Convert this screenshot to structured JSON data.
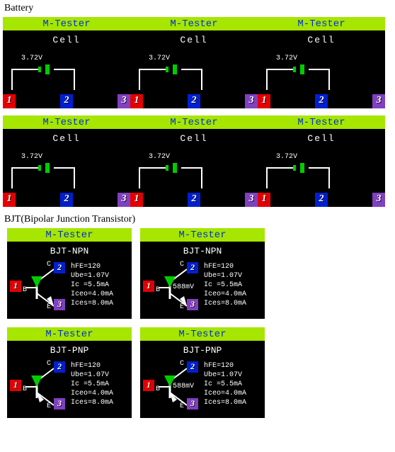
{
  "sections": {
    "battery": "Battery",
    "bjt": "BJT(Bipolar Junction Transistor)"
  },
  "header": "M-Tester",
  "cell": {
    "label": "Cell",
    "voltage": "3.72V"
  },
  "pins": {
    "p1": "1",
    "p2": "2",
    "p3": "3"
  },
  "terms": {
    "B": "B",
    "C": "C",
    "E": "E"
  },
  "bjt": {
    "npn": "BJT-NPN",
    "pnp": "BJT-PNP",
    "vbe_inline": "588mV",
    "params": {
      "hfe": "hFE=120",
      "ube": "Ube=1.07V",
      "ic": "Ic =5.5mA",
      "iceo": "Iceo=4.0mA",
      "ices": "Ices=8.0mA"
    }
  }
}
